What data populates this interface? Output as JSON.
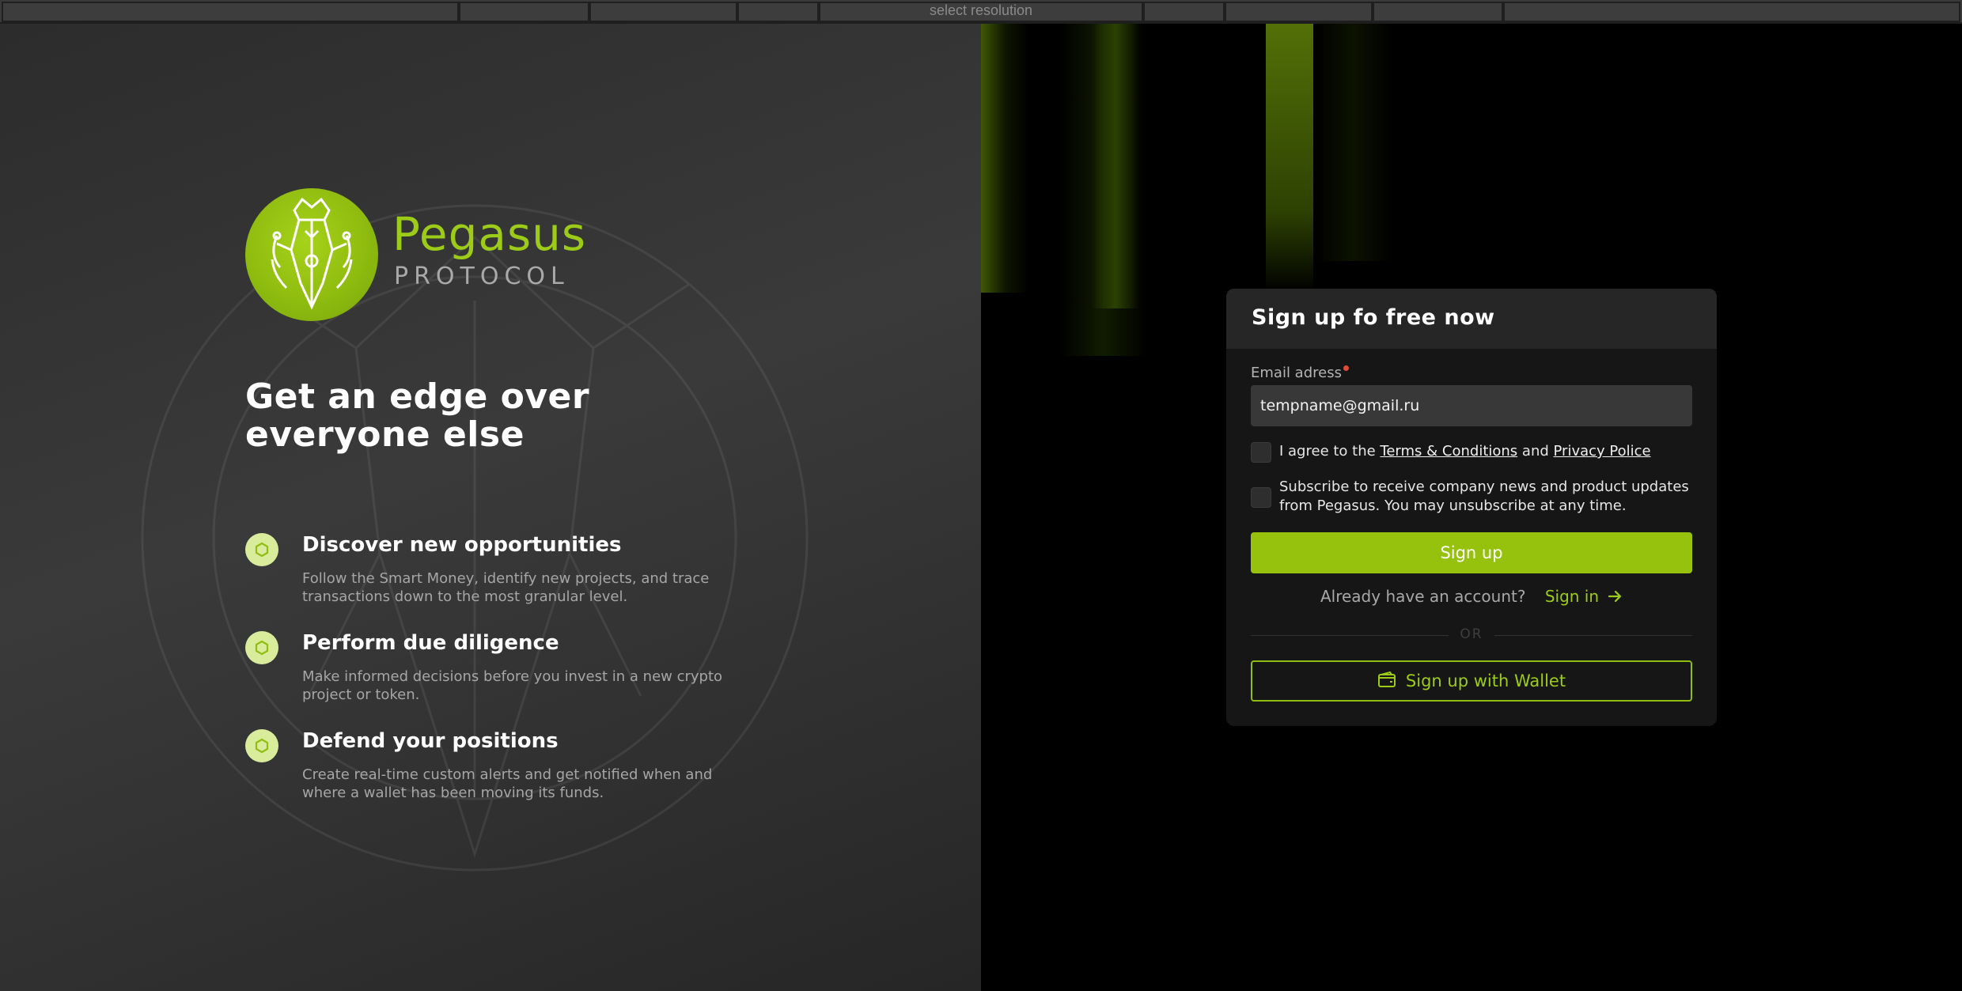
{
  "resolution_bar": {
    "label": "select resolution"
  },
  "brand": {
    "name": "Pegasus",
    "sub": "PROTOCOL"
  },
  "headline": {
    "line1": "Get an edge over",
    "line2": "everyone else"
  },
  "features": [
    {
      "title": "Discover new opportunities",
      "desc": "Follow the Smart Money, identify new projects, and trace transactions down to the most granular level."
    },
    {
      "title": "Perform due diligence",
      "desc": "Make informed decisions before you invest in a new crypto project or token."
    },
    {
      "title": "Defend your positions",
      "desc": "Create real-time custom alerts and get notified when and where a wallet has been moving its funds."
    }
  ],
  "form": {
    "title": "Sign up fo free now",
    "email_label": "Email adress",
    "email_value": "tempname@gmail.ru",
    "agree_prefix": "I agree to the ",
    "terms_link": "Terms & Conditions",
    "agree_and": " and ",
    "privacy_link": "Privacy Police",
    "subscribe_text": "Subscribe to receive company news and product updates from Pegasus. You may unsubscribe at any time.",
    "signup_label": "Sign up",
    "account_question": "Already have an account?",
    "signin_label": "Sign in",
    "or_label": "OR",
    "wallet_label": "Sign up with Wallet"
  },
  "colors": {
    "accent": "#96c10c",
    "brand_green": "#9ccc18",
    "required": "#e24a3b"
  }
}
